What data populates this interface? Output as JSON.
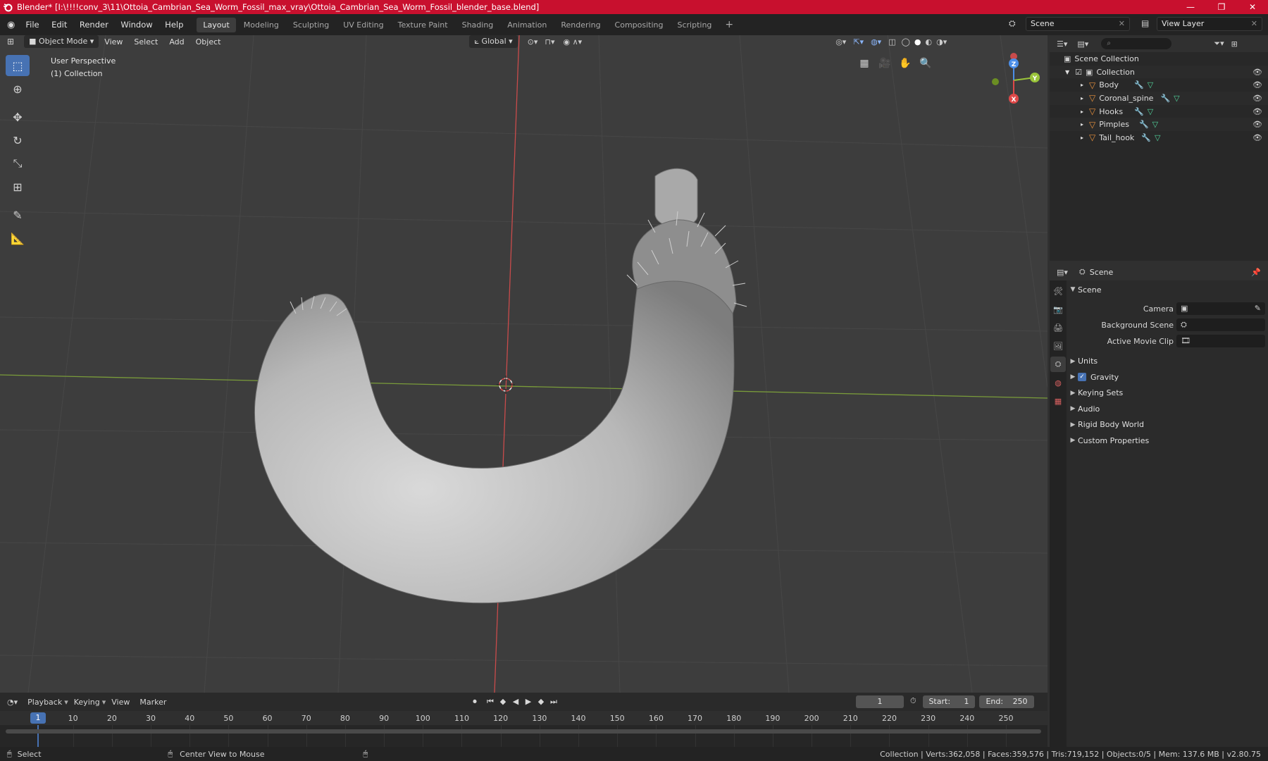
{
  "window": {
    "title": "Blender* [I:\\!!!!conv_3\\11\\Ottoia_Cambrian_Sea_Worm_Fossil_max_vray\\Ottoia_Cambrian_Sea_Worm_Fossil_blender_base.blend]",
    "controls": [
      "—",
      "❐",
      "✕"
    ]
  },
  "menu": [
    "File",
    "Edit",
    "Render",
    "Window",
    "Help"
  ],
  "workspaces": [
    "Layout",
    "Modeling",
    "Sculpting",
    "UV Editing",
    "Texture Paint",
    "Shading",
    "Animation",
    "Rendering",
    "Compositing",
    "Scripting"
  ],
  "active_workspace": "Layout",
  "scene_selector": {
    "label": "Scene"
  },
  "view_layer_selector": {
    "label": "View Layer"
  },
  "viewport": {
    "mode": "Object Mode",
    "menus": [
      "View",
      "Select",
      "Add",
      "Object"
    ],
    "transform_orientation": "Global",
    "overlay_line1": "User Perspective",
    "overlay_line2": "(1) Collection",
    "gizmo": {
      "x": "X",
      "y": "Y",
      "z": "Z"
    }
  },
  "toolbar_icons": [
    "select-box-icon",
    "cursor-icon",
    "move-icon",
    "rotate-icon",
    "scale-icon",
    "transform-icon",
    "annotate-icon",
    "measure-icon"
  ],
  "outliner": {
    "search_placeholder": "",
    "root": "Scene Collection",
    "collection": "Collection",
    "items": [
      {
        "name": "Body"
      },
      {
        "name": "Coronal_spine"
      },
      {
        "name": "Hooks"
      },
      {
        "name": "Pimples"
      },
      {
        "name": "Tail_hook"
      }
    ]
  },
  "properties": {
    "header": "Scene",
    "panel": "Scene",
    "fields": [
      {
        "label": "Camera",
        "value": ""
      },
      {
        "label": "Background Scene",
        "value": ""
      },
      {
        "label": "Active Movie Clip",
        "value": ""
      }
    ],
    "sections": [
      {
        "label": "Units",
        "checkbox": false
      },
      {
        "label": "Gravity",
        "checkbox": true
      },
      {
        "label": "Keying Sets",
        "checkbox": false
      },
      {
        "label": "Audio",
        "checkbox": false
      },
      {
        "label": "Rigid Body World",
        "checkbox": false
      },
      {
        "label": "Custom Properties",
        "checkbox": false
      }
    ]
  },
  "timeline": {
    "menus": [
      "Playback",
      "Keying",
      "View",
      "Marker"
    ],
    "current_frame": "1",
    "start_label": "Start:",
    "start": "1",
    "end_label": "End:",
    "end": "250",
    "ticks": [
      "1",
      "10",
      "20",
      "30",
      "40",
      "50",
      "60",
      "70",
      "80",
      "90",
      "100",
      "110",
      "120",
      "130",
      "140",
      "150",
      "160",
      "170",
      "180",
      "190",
      "200",
      "210",
      "220",
      "230",
      "240",
      "250"
    ]
  },
  "statusbar": {
    "left": "Select",
    "middle": "Center View to Mouse",
    "stats": "Collection | Verts:362,058 | Faces:359,576 | Tris:719,152 | Objects:0/5 | Mem: 137.6 MB | v2.80.75"
  },
  "colors": {
    "title_bar": "#c8102e",
    "accent": "#4772b3",
    "viewport_bg": "#3d3d3d",
    "object_orange": "#e8913c",
    "axis_red": "#c94b4b",
    "axis_green": "#7a9c3a"
  }
}
